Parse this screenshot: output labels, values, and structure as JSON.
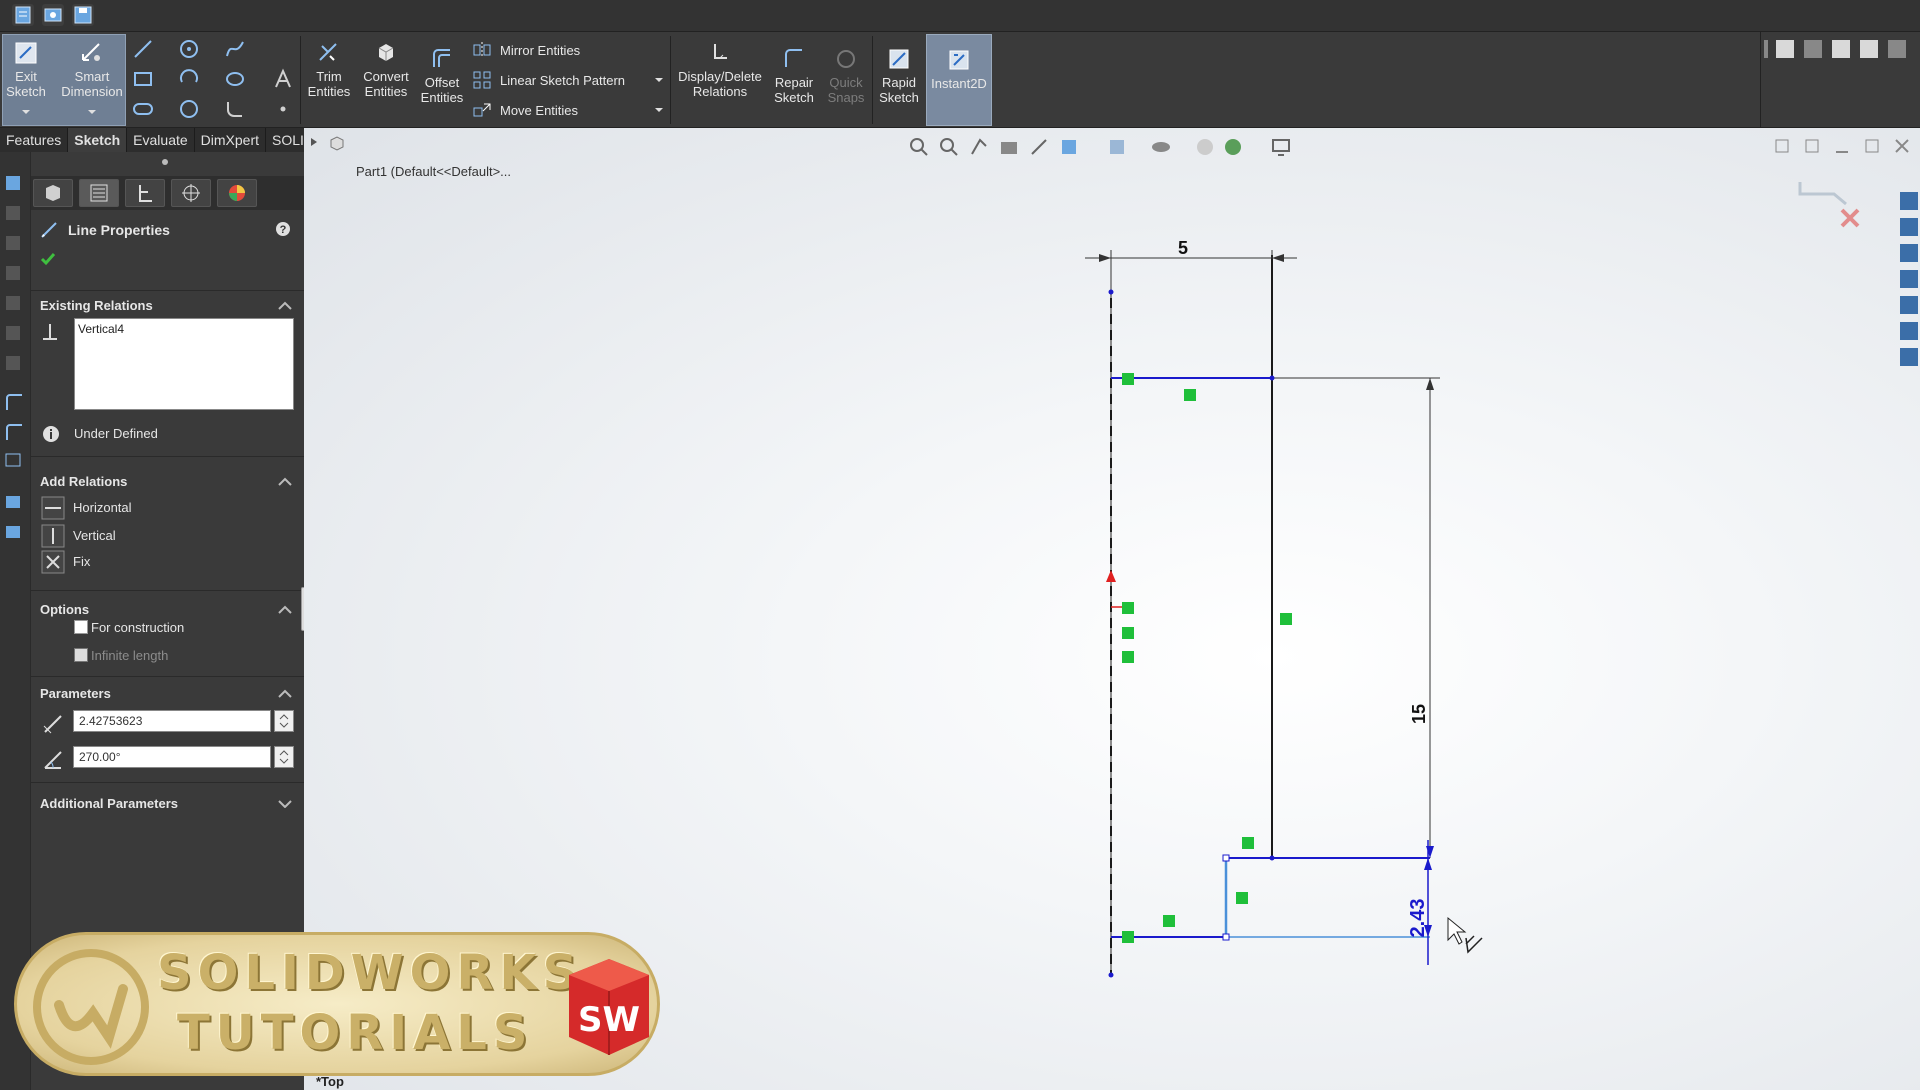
{
  "ribbon": {
    "exit_sketch": "Exit\nSketch",
    "smart_dimension": "Smart\nDimension",
    "trim_entities": "Trim\nEntities",
    "convert_entities": "Convert\nEntities",
    "offset_entities": "Offset\nEntities",
    "mirror_entities": "Mirror Entities",
    "linear_sketch_pattern": "Linear Sketch Pattern",
    "move_entities": "Move Entities",
    "display_delete_relations": "Display/Delete\nRelations",
    "repair_sketch": "Repair\nSketch",
    "quick_snaps": "Quick\nSnaps",
    "rapid_sketch": "Rapid\nSketch",
    "instant2d": "Instant2D"
  },
  "tabs": [
    "Features",
    "Sketch",
    "Evaluate",
    "DimXpert",
    "SOLIDWORKS Add-Ins"
  ],
  "active_tab": "Sketch",
  "tree": {
    "item": "Part1  (Default<<Default>..."
  },
  "property_manager": {
    "title": "Line Properties",
    "existing_relations": {
      "title": "Existing Relations",
      "items": [
        "Vertical4"
      ],
      "status": "Under Defined"
    },
    "add_relations": {
      "title": "Add Relations",
      "items": [
        "Horizontal",
        "Vertical",
        "Fix"
      ]
    },
    "options": {
      "title": "Options",
      "for_construction": "For construction",
      "infinite_length": "Infinite length"
    },
    "parameters": {
      "title": "Parameters",
      "length": "2.42753623",
      "angle": "270.00°"
    },
    "additional_parameters": "Additional Parameters"
  },
  "sketch": {
    "dim_top": "5",
    "dim_right": "15",
    "dim_bottom": "2.43"
  },
  "view_label": "*Top",
  "watermark": {
    "line1": "SOLIDWORKS",
    "line2": "TUTORIALS",
    "badge": "SW"
  },
  "colors": {
    "sketch_blue": "#1a1acc",
    "relation_green": "#1fbf3a",
    "selected_blue": "#4a90d9",
    "ribbon_active": "#7a8aa0"
  }
}
